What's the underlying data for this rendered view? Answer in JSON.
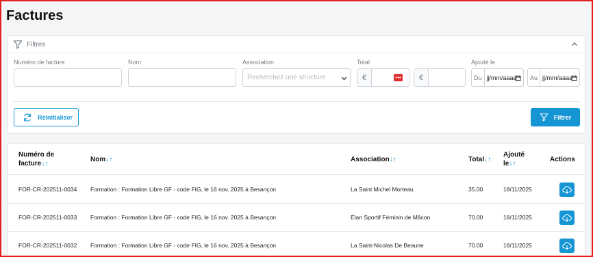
{
  "page": {
    "title": "Factures"
  },
  "filters": {
    "header_title": "Filtres",
    "invoice_number_label": "Numéro de facture",
    "name_label": "Nom",
    "association_label": "Association",
    "association_placeholder": "Recherchez une structure",
    "total_label": "Total",
    "currency_symbol": "€",
    "added_label": "Ajouté le",
    "date_from_prefix": "Du",
    "date_to_prefix": "Au",
    "date_placeholder": "jj/mm/aaaa",
    "reset_label": "Réinitialiser",
    "filter_label": "Filtrer"
  },
  "table": {
    "columns": {
      "invoice_number_line1": "Numéro de",
      "invoice_number_line2": "facture",
      "name": "Nom",
      "association": "Association",
      "total": "Total",
      "added_line1": "Ajouté",
      "added_line2": "le",
      "actions": "Actions",
      "sort_symbol": "↓↑"
    },
    "rows": [
      {
        "number": "FOR-CR-202511-0034",
        "name": "Formation : Formation Libre GF - code FIG, le 16 nov. 2025 à Besançon",
        "association": "La Saint Michel Morteau",
        "total": "35.00",
        "date": "18/11/2025"
      },
      {
        "number": "FOR-CR-202511-0033",
        "name": "Formation : Formation Libre GF - code FIG, le 16 nov. 2025 à Besançon",
        "association": "Élan Sportif Féminin de Mâcon",
        "total": "70.00",
        "date": "18/11/2025"
      },
      {
        "number": "FOR-CR-202511-0032",
        "name": "Formation : Formation Libre GF - code FIG, le 16 nov. 2025 à Besançon",
        "association": "La Saint-Nicolas De Beaune",
        "total": "70.00",
        "date": "18/11/2025"
      }
    ]
  },
  "colors": {
    "accent": "#1595d3",
    "frame": "#e41f1f",
    "danger": "#e03131"
  },
  "icons": [
    "funnel-icon",
    "chevron-up-icon",
    "refresh-icon",
    "calendar-icon",
    "cloud-download-icon"
  ]
}
